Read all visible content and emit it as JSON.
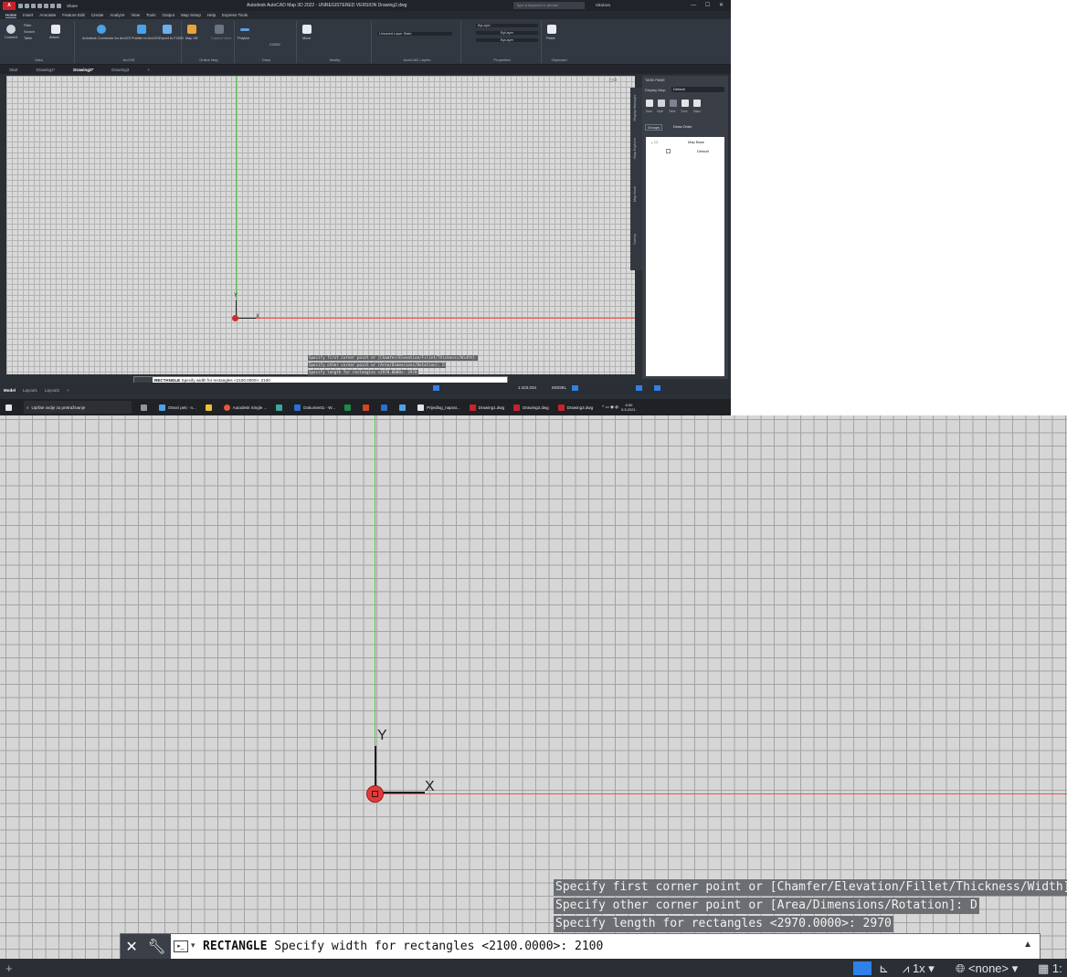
{
  "app": {
    "logo": "A",
    "title": "Autodesk AutoCAD Map 3D 2022 - UNREGISTERED VERSION   Drawing2.dwg",
    "search_placeholder": "Type a keyword or phrase",
    "user": "nikolavs",
    "share_label": "Share"
  },
  "menu_tabs": [
    "Home",
    "Insert",
    "Annotate",
    "Feature Edit",
    "Create",
    "Analyze",
    "View",
    "Tools",
    "Output",
    "Map Setup",
    "Help",
    "Express Tools"
  ],
  "ribbon": {
    "groups": [
      {
        "label": "Data",
        "items": [
          "Connect",
          "Filter",
          "Search",
          "Table",
          "Attach"
        ]
      },
      {
        "label": "ArcGIS",
        "items": [
          "Autodesk Connector for ArcGIS",
          "Publish to ArcGIS",
          "Export to FGDB"
        ]
      },
      {
        "label": "Online Map",
        "items": [
          "Map Off",
          "Capture Area"
        ]
      },
      {
        "label": "Draw",
        "items": [
          "Polyline",
          "COGO"
        ]
      },
      {
        "label": "Modify",
        "items": [
          "Move"
        ]
      },
      {
        "label": "AutoCAD Layers",
        "items": [
          "Unsaved Layer State"
        ]
      },
      {
        "label": "Properties",
        "items": [
          "ByLayer",
          "ByLayer",
          "ByLayer"
        ]
      },
      {
        "label": "Clipboard",
        "items": [
          "Paste"
        ]
      }
    ]
  },
  "doc_tabs": [
    {
      "label": "Start",
      "active": false
    },
    {
      "label": "Drawing1*",
      "active": false
    },
    {
      "label": "Drawing2*",
      "active": true
    },
    {
      "label": "Drawing3",
      "active": false
    }
  ],
  "task_pane": {
    "title": "TASK PANE",
    "display_map_label": "Display Map:",
    "display_map_value": "Default",
    "tool_labels": [
      "Data",
      "Style",
      "Table",
      "Tools",
      "Maps"
    ],
    "groups_label": "Groups",
    "draw_order_label": "Draw Order",
    "tree": [
      "Map Base",
      "Default"
    ],
    "side_tabs": [
      "Display Manager",
      "Map Explorer",
      "Map Book",
      "Survey"
    ]
  },
  "layout_tabs": [
    "Model",
    "Layout1",
    "Layout2"
  ],
  "command": {
    "history": [
      "Specify first corner point or [Chamfer/Elevation/Fillet/Thickness/Width]:",
      "Specify other corner point or [Area/Dimensions/Rotation]: D",
      "Specify length for rectangles <2970.0000>: 2970"
    ],
    "name": "RECTANGLE",
    "prompt": "Specify width for rectangles <2100.0000>:",
    "value": "2100"
  },
  "status": {
    "scale": "1:423,034",
    "mode": "MODEL",
    "annoscale": "1x",
    "coord_system": "<none>",
    "ratio_fragment": "1:"
  },
  "taskbar": {
    "search_placeholder": "Upišite ovdje za pretraživanje",
    "apps": [
      "Otvori peti - n...",
      "Autodesk Single ...",
      "Dokument1 - W...",
      "Prijedlog_naprat...",
      "Drawing1.dwg",
      "Drawing2.dwg",
      "Drawing3.dwg"
    ],
    "time": "8:50",
    "date": "5.5.2021."
  },
  "ucs": {
    "x": "X",
    "y": "Y"
  },
  "colors": {
    "axis_y": "#52c74a",
    "axis_x": "#e05a52",
    "grid_bg": "#d6d6d6",
    "accent": "#2f80e8"
  }
}
